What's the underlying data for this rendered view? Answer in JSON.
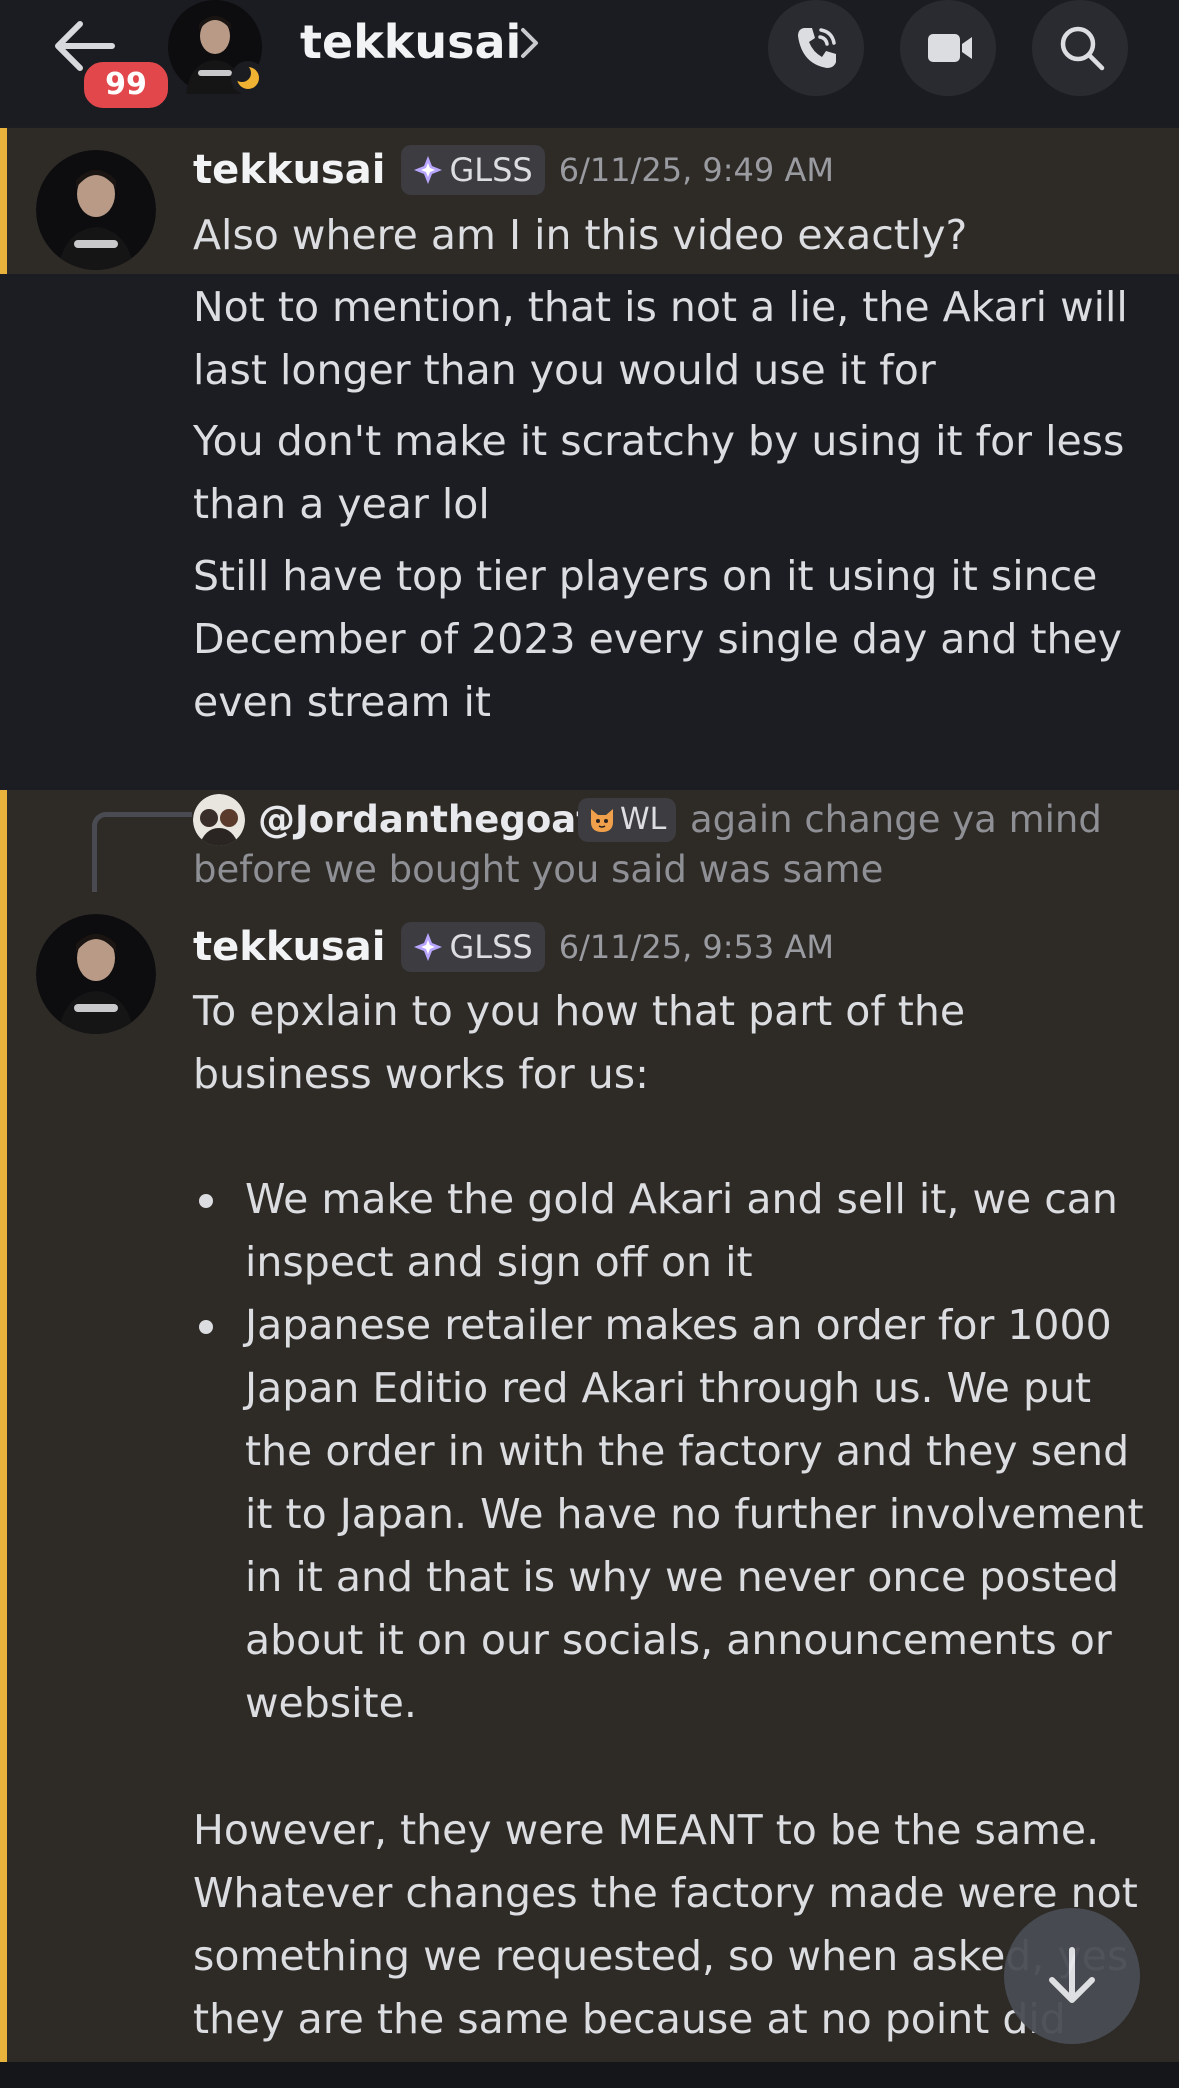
{
  "header": {
    "unread_count": "99",
    "title": "tekkusai",
    "icons": [
      "arrow-left-icon",
      "phone-icon",
      "video-camera-icon",
      "search-icon",
      "chevron-right-icon",
      "moon-icon"
    ]
  },
  "messages": [
    {
      "author": "tekkusai",
      "role_tag": "GLSS",
      "timestamp": "6/11/25, 9:49 AM",
      "lines": [
        "Also where am I in this video exactly?",
        "Not to mention, that is not a lie, the Akari will last longer than you would use it for",
        "You don't make it scratchy by using it for less than a year lol",
        "Still have top tier players on it using it since December of 2023 every single day and they even stream it"
      ]
    },
    {
      "reply": {
        "author": "@Jordanthegoat",
        "role_tag": "WL",
        "text_line_1": "again change ya mind",
        "text_line_2": "before we bought you said was same"
      },
      "author": "tekkusai",
      "role_tag": "GLSS",
      "timestamp": "6/11/25, 9:53 AM",
      "intro": "To epxlain to you how that part of the business works for us:",
      "bullets": [
        "We make the gold Akari and sell it, we can inspect and sign off on it",
        "Japanese retailer makes an order for 1000 Japan Editio red Akari through us. We put the order in with the factory and they send it to Japan. We have no further involvement in it and that is why we never once posted about it on our socials, announcements or website."
      ],
      "outro": "However, they were MEANT to be the same. Whatever changes the factory made were not something we requested, so when asked, yes they are the same because at no point did"
    }
  ],
  "colors": {
    "background": "#1c1d23",
    "highlight": "#2e2b27",
    "highlight_bar": "#e9b23d",
    "badge": "#e2484b"
  }
}
